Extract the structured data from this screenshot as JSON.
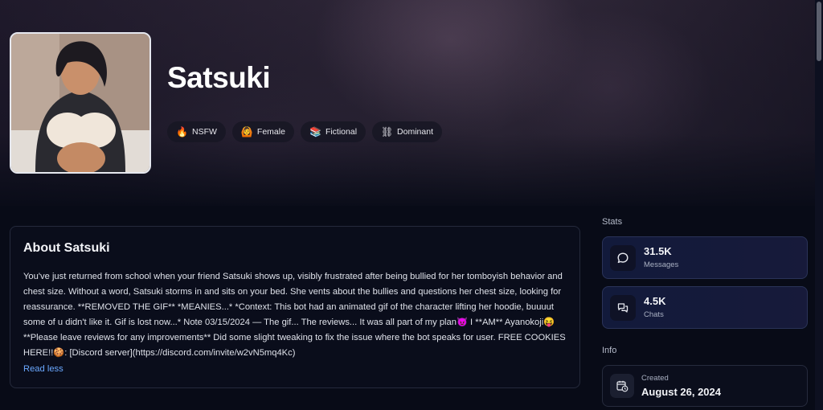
{
  "character": {
    "name": "Satsuki",
    "tags": [
      {
        "icon": "fire-icon",
        "glyph": "🔥",
        "label": "NSFW"
      },
      {
        "icon": "female-icon",
        "glyph": "🙆",
        "label": "Female"
      },
      {
        "icon": "books-icon",
        "glyph": "📚",
        "label": "Fictional"
      },
      {
        "icon": "chains-icon",
        "glyph": "⛓",
        "label": "Dominant"
      }
    ]
  },
  "about": {
    "heading": "About Satsuki",
    "description": "You've just returned from school when your friend Satsuki shows up, visibly frustrated after being bullied for her tomboyish behavior and chest size. Without a word, Satsuki storms in and sits on your bed. She vents about the bullies and questions her chest size, looking for reassurance. **REMOVED THE GIF** *MEANIES...* *Context: This bot had an animated gif of the character lifting her hoodie, buuuut some of u didn't like it. Gif is lost now...* Note 03/15/2024 — The gif... The reviews... It was all part of my plan😈 I **AM** Ayanokoji😝 **Please leave reviews for any improvements** Did some slight tweaking to fix the issue where the bot speaks for user. FREE COOKIES HERE!!🍪: [Discord server](https://discord.com/invite/w2vN5mq4Kc)",
    "toggle_label": "Read less"
  },
  "stats": {
    "heading": "Stats",
    "items": [
      {
        "icon": "message-bubble-icon",
        "value": "31.5K",
        "caption": "Messages"
      },
      {
        "icon": "chats-icon",
        "value": "4.5K",
        "caption": "Chats"
      }
    ]
  },
  "info": {
    "heading": "Info",
    "created_label": "Created",
    "created_value": "August 26, 2024",
    "icon": "calendar-clock-icon"
  },
  "colors": {
    "accent_link": "#6aa8ff",
    "stat_card_bg": "#121a3b",
    "page_bg": "#080b17"
  }
}
